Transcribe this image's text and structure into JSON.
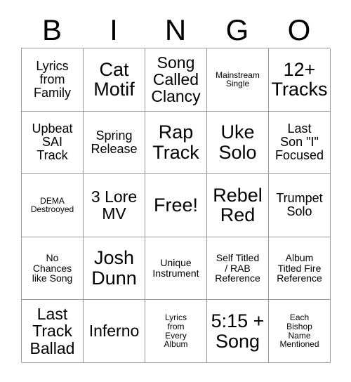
{
  "card": {
    "title": "BINGO",
    "header_letters": [
      "B",
      "I",
      "N",
      "G",
      "O"
    ],
    "border_color": "#9a9a9a",
    "text_color": "#000000",
    "background_color": "#ffffff",
    "columns": 5,
    "rows": 5
  },
  "cells": [
    {
      "text": "Lyrics\nfrom\nFamily",
      "size": "md"
    },
    {
      "text": "Cat\nMotif",
      "size": "xl"
    },
    {
      "text": "Song\nCalled\nClancy",
      "size": "lg"
    },
    {
      "text": "Mainstream\nSingle",
      "size": "xs"
    },
    {
      "text": "12+\nTracks",
      "size": "xl"
    },
    {
      "text": "Upbeat\nSAI\nTrack",
      "size": "md"
    },
    {
      "text": "Spring\nRelease",
      "size": "md"
    },
    {
      "text": "Rap\nTrack",
      "size": "xl"
    },
    {
      "text": "Uke\nSolo",
      "size": "xl"
    },
    {
      "text": "Last\nSon \"I\"\nFocused",
      "size": "md"
    },
    {
      "text": "DEMA\nDestrooyed",
      "size": "xs"
    },
    {
      "text": "3 Lore\nMV",
      "size": "lg"
    },
    {
      "text": "Free!",
      "size": "xl"
    },
    {
      "text": "Rebel\nRed",
      "size": "xl"
    },
    {
      "text": "Trumpet\nSolo",
      "size": "md"
    },
    {
      "text": "No\nChances\nlike Song",
      "size": "sm"
    },
    {
      "text": "Josh\nDunn",
      "size": "xl"
    },
    {
      "text": "Unique\nInstrument",
      "size": "sm"
    },
    {
      "text": "Self Titled\n/ RAB\nReference",
      "size": "sm"
    },
    {
      "text": "Album\nTitled Fire\nReference",
      "size": "sm"
    },
    {
      "text": "Last\nTrack\nBallad",
      "size": "lg"
    },
    {
      "text": "Inferno",
      "size": "lg"
    },
    {
      "text": "Lyrics\nfrom\nEvery\nAlbum",
      "size": "xs"
    },
    {
      "text": "5:15 +\nSong",
      "size": "xl"
    },
    {
      "text": "Each\nBishop\nName\nMentioned",
      "size": "xs"
    }
  ]
}
